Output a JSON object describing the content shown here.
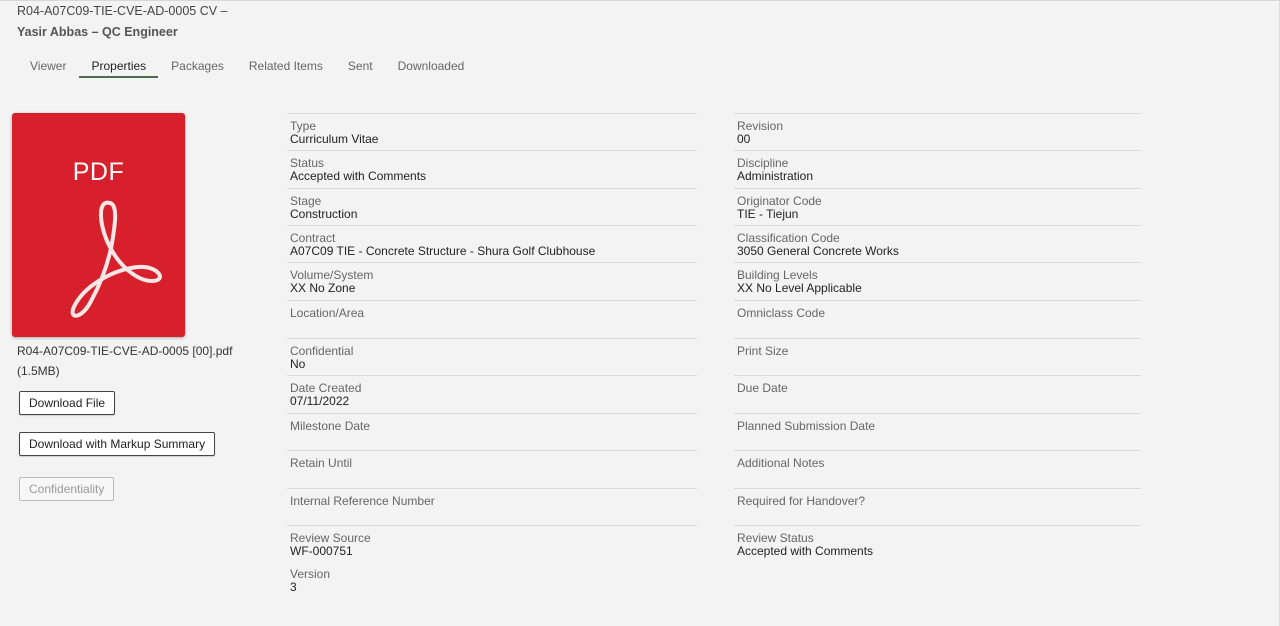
{
  "document": {
    "title_line1": "R04-A07C09-TIE-CVE-AD-0005 CV –",
    "title_line2": "Yasir Abbas – QC Engineer"
  },
  "tabs": [
    {
      "label": "Viewer",
      "active": false
    },
    {
      "label": "Properties",
      "active": true
    },
    {
      "label": "Packages",
      "active": false
    },
    {
      "label": "Related Items",
      "active": false
    },
    {
      "label": "Sent",
      "active": false
    },
    {
      "label": "Downloaded",
      "active": false
    }
  ],
  "file": {
    "badge": "PDF",
    "icon": "pdf-acrobat-icon",
    "name": "R04-A07C09-TIE-CVE-AD-0005 [00].pdf",
    "size": "(1.5MB)",
    "accent_color": "#d8202c"
  },
  "buttons": {
    "download_file": "Download File",
    "download_markup": "Download with Markup Summary",
    "confidentiality": "Confidentiality"
  },
  "properties_left": [
    {
      "label": "Type",
      "value": "Curriculum Vitae"
    },
    {
      "label": "Status",
      "value": "Accepted with Comments"
    },
    {
      "label": "Stage",
      "value": "Construction"
    },
    {
      "label": "Contract",
      "value": "A07C09 TIE - Concrete Structure - Shura Golf Clubhouse"
    },
    {
      "label": "Volume/System",
      "value": "XX No Zone"
    },
    {
      "label": "Location/Area",
      "value": ""
    },
    {
      "label": "Confidential",
      "value": "No"
    },
    {
      "label": "Date Created",
      "value": "07/11/2022"
    },
    {
      "label": "Milestone Date",
      "value": ""
    },
    {
      "label": "Retain Until",
      "value": ""
    },
    {
      "label": "Internal Reference Number",
      "value": ""
    },
    {
      "label": "Review Source",
      "value": "WF-000751"
    },
    {
      "label": "Version",
      "value": "3"
    }
  ],
  "properties_right": [
    {
      "label": "Revision",
      "value": "00"
    },
    {
      "label": "Discipline",
      "value": "Administration"
    },
    {
      "label": "Originator Code",
      "value": "TIE - Tiejun"
    },
    {
      "label": "Classification Code",
      "value": "3050 General Concrete Works"
    },
    {
      "label": "Building Levels",
      "value": "XX No Level Applicable"
    },
    {
      "label": "Omniclass Code",
      "value": ""
    },
    {
      "label": "Print Size",
      "value": ""
    },
    {
      "label": "Due Date",
      "value": ""
    },
    {
      "label": "Planned Submission Date",
      "value": ""
    },
    {
      "label": "Additional Notes",
      "value": ""
    },
    {
      "label": "Required for Handover?",
      "value": ""
    },
    {
      "label": "Review Status",
      "value": "Accepted with Comments"
    }
  ]
}
